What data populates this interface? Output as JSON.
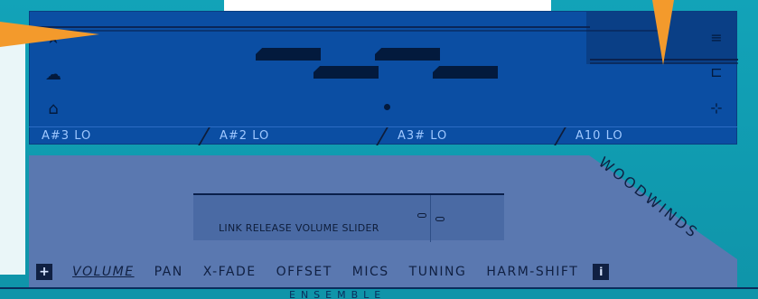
{
  "tabs": [
    {
      "label": "A#3 LO"
    },
    {
      "label": "A#2 LO"
    },
    {
      "label": "A3# LO"
    },
    {
      "label": "A10 LO"
    }
  ],
  "slider": {
    "label": "LINK RELEASE VOLUME SLIDER"
  },
  "tools": [
    {
      "label": "VOLUME",
      "active": true
    },
    {
      "label": "PAN"
    },
    {
      "label": "X-FADE"
    },
    {
      "label": "OFFSET"
    },
    {
      "label": "MICS"
    },
    {
      "label": "TUNING"
    },
    {
      "label": "HARM-SHIFT"
    }
  ],
  "add_button": {
    "label": "+"
  },
  "info_button": {
    "label": "i"
  },
  "brand": {
    "text": "WOODWINDS"
  },
  "footer": {
    "text": "ENSEMBLE"
  },
  "icons": {
    "top_left_1": "star-icon",
    "top_left_2": "cloud-icon",
    "top_left_3": "house-icon",
    "top_right_1": "menu-lines-icon",
    "top_right_2": "bracket-icon",
    "top_right_3": "node-icon"
  },
  "colors": {
    "accent": "#f39a2c",
    "panel_dark": "#0b4ea3",
    "panel_light": "#5a78b0",
    "teal": "#12a3b8"
  }
}
